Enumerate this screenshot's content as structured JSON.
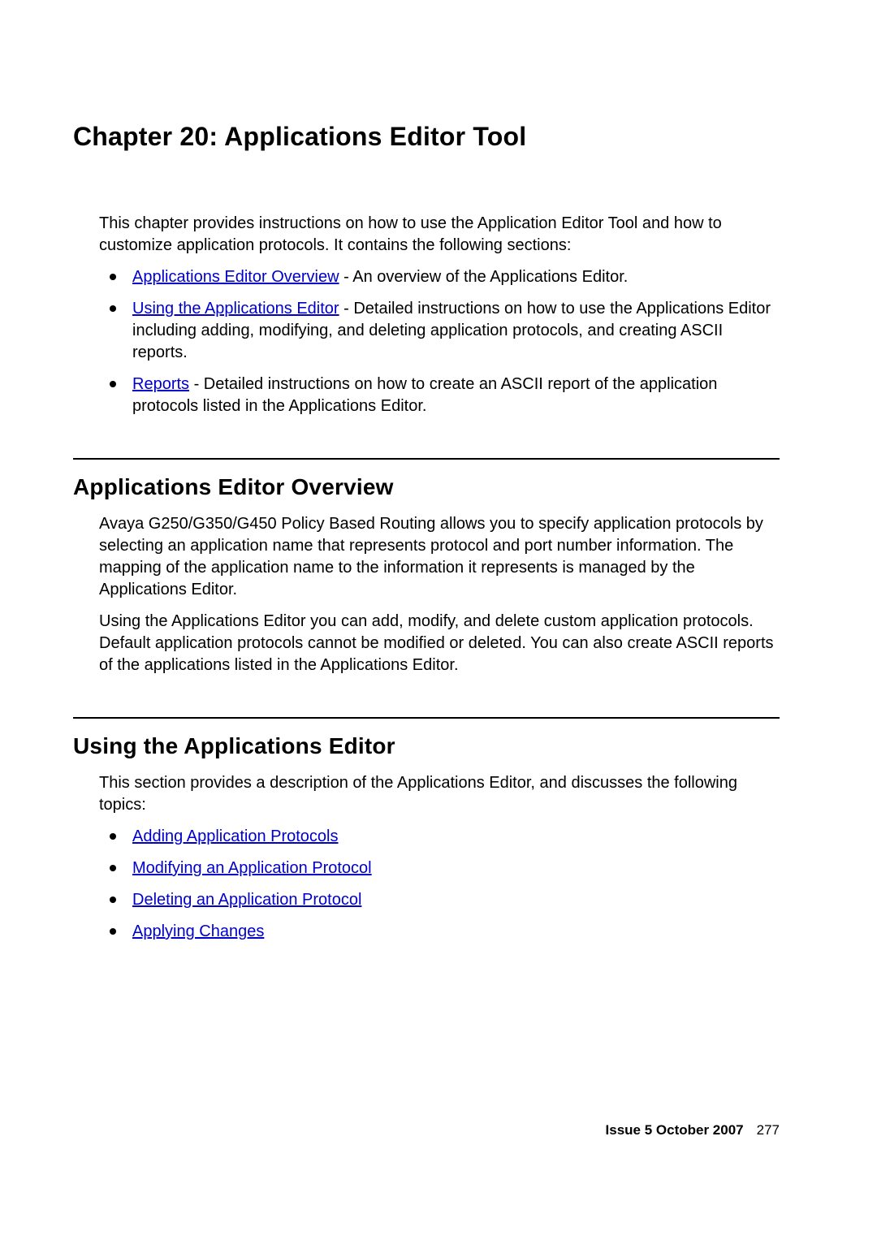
{
  "chapter": {
    "title": "Chapter 20: Applications Editor Tool"
  },
  "intro": {
    "text": "This chapter provides instructions on how to use the Application Editor Tool and how to customize application protocols. It contains the following sections:",
    "items": [
      {
        "link": "Applications Editor Overview",
        "desc": " - An overview of the Applications Editor."
      },
      {
        "link": "Using the Applications Editor",
        "desc": " - Detailed instructions on how to use the Applications Editor including adding, modifying, and deleting application protocols, and creating ASCII reports."
      },
      {
        "link": "Reports",
        "desc": " - Detailed instructions on how to create an ASCII report of the application protocols listed in the Applications Editor."
      }
    ]
  },
  "section_overview": {
    "heading": "Applications Editor Overview",
    "p1": "Avaya G250/G350/G450 Policy Based Routing allows you to specify application protocols by selecting an application name that represents protocol and port number information. The mapping of the application name to the information it represents is managed by the Applications Editor.",
    "p2": "Using the Applications Editor you can add, modify, and delete custom application protocols. Default application protocols cannot be modified or deleted. You can also create ASCII reports of the applications listed in the Applications Editor."
  },
  "section_using": {
    "heading": "Using the Applications Editor",
    "p1": "This section provides a description of the Applications Editor, and discusses the following topics:",
    "items": [
      {
        "link": "Adding Application Protocols"
      },
      {
        "link": "Modifying an Application Protocol"
      },
      {
        "link": "Deleting an Application Protocol"
      },
      {
        "link": "Applying Changes"
      }
    ]
  },
  "footer": {
    "issue": "Issue 5   October 2007",
    "page": "277"
  }
}
